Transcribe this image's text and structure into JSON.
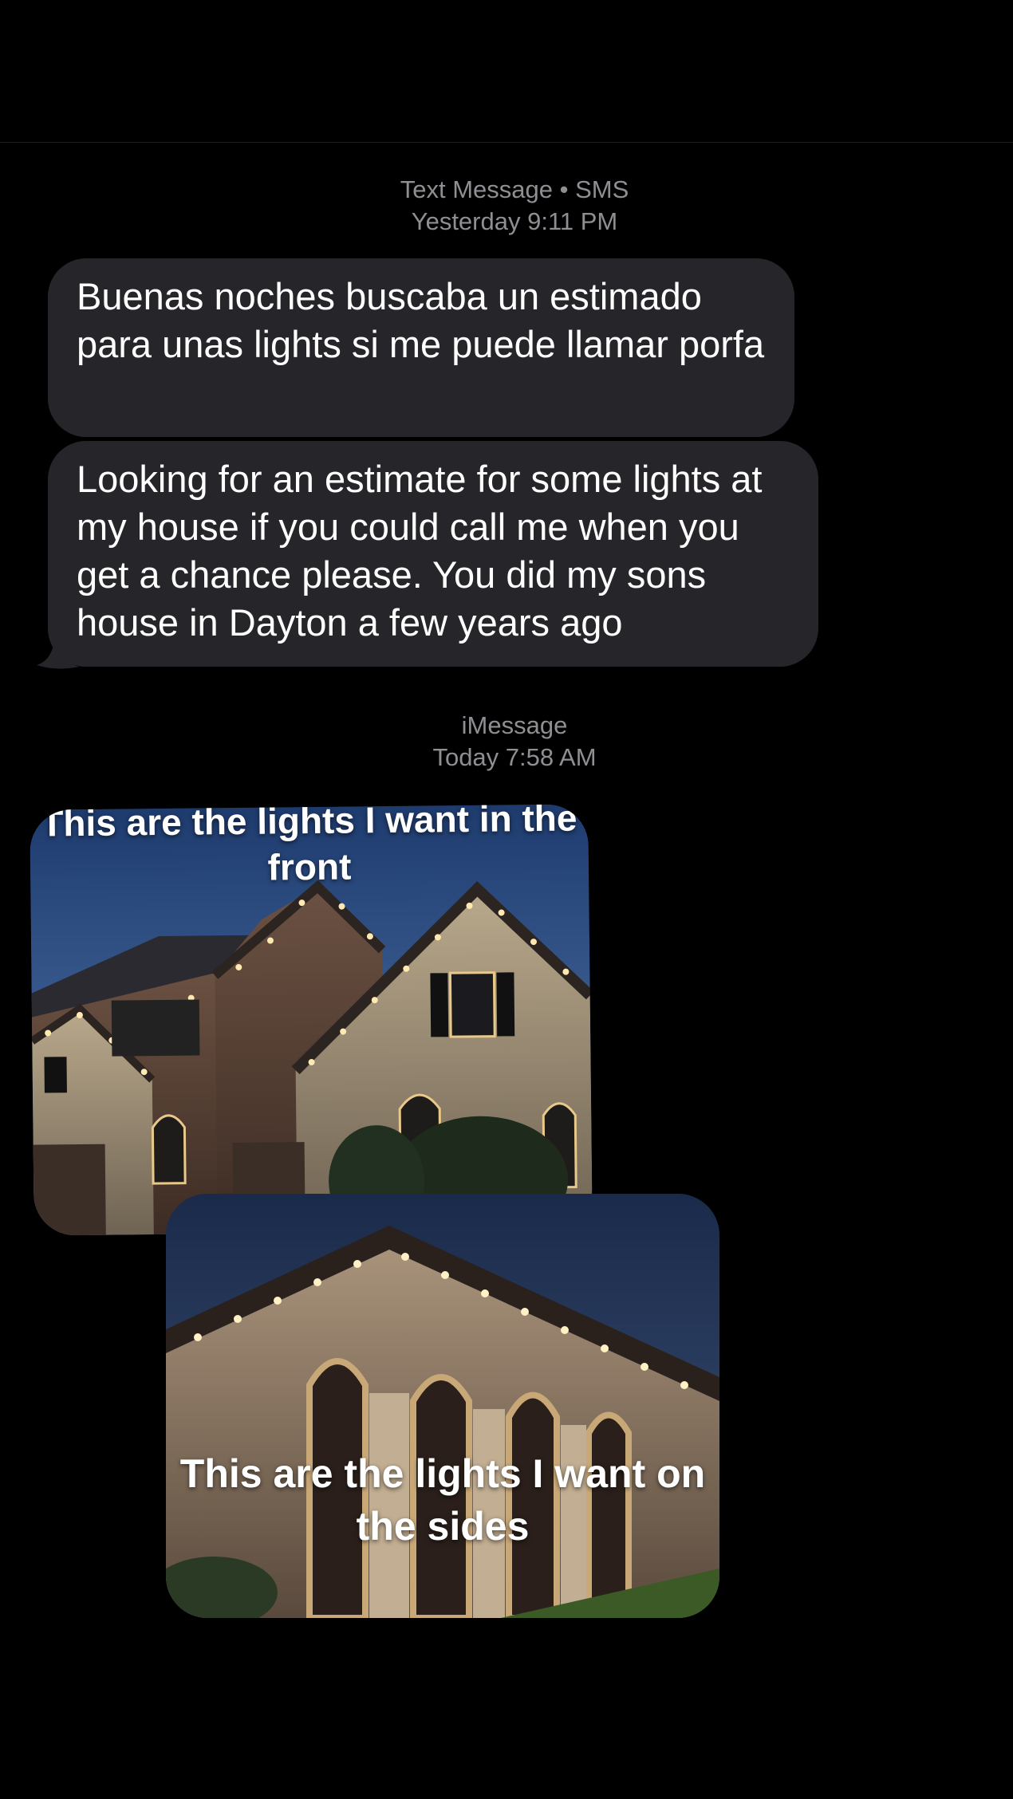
{
  "header": {
    "service": "Text Message • SMS",
    "time": "Yesterday 9:11 PM"
  },
  "messages": [
    {
      "text": "Buenas noches buscaba un estimado para unas lights si me puede llamar porfa"
    },
    {
      "text": "Looking for an estimate for some lights at my house if you could call me when you get a chance please. You did my sons house in Dayton a few years ago"
    }
  ],
  "imessage_header": {
    "service": "iMessage",
    "time": "Today 7:58 AM"
  },
  "photos": [
    {
      "caption": "This are the lights I want in the front",
      "icon": "house-front-photo"
    },
    {
      "caption": "This are the lights I want on the sides",
      "icon": "house-side-photo"
    }
  ],
  "colors": {
    "background": "#000000",
    "bubble": "#26252a",
    "meta_text": "#8e8e93"
  }
}
